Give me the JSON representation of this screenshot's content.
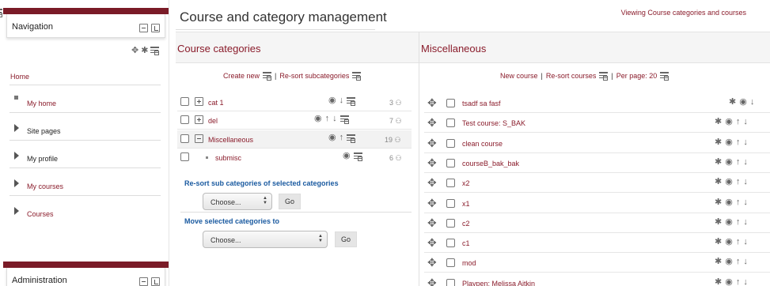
{
  "header": {
    "title": "Course and category management",
    "view_link": "Viewing Course categories and courses"
  },
  "navigation_block": {
    "title": "Navigation",
    "items": [
      {
        "label": "Home"
      },
      {
        "label": "My home"
      },
      {
        "label": "Site pages"
      },
      {
        "label": "My profile"
      },
      {
        "label": "My courses"
      },
      {
        "label": "Courses"
      }
    ]
  },
  "admin_block": {
    "title": "Administration"
  },
  "categories_panel": {
    "title": "Course categories",
    "create_new": "Create new",
    "resort": "Re-sort subcategories",
    "rows": [
      {
        "name": "cat 1",
        "count": "3"
      },
      {
        "name": "del",
        "count": "7"
      },
      {
        "name": "Miscellaneous",
        "count": "19"
      },
      {
        "name": "submisc",
        "count": "6"
      }
    ],
    "bulk": {
      "resort_title": "Re-sort sub categories of selected categories",
      "resort_select": "Choose...",
      "go": "Go",
      "move_title": "Move selected categories to",
      "move_select": "Choose..."
    }
  },
  "courses_panel": {
    "title": "Miscellaneous",
    "new_course": "New course",
    "resort_courses": "Re-sort courses",
    "per_page": "Per page: 20",
    "courses": [
      "tsadf sa fasf",
      "Test course: S_BAK",
      "clean course",
      "courseB_bak_bak",
      "x2",
      "x1",
      "c2",
      "c1",
      "mod",
      "Playpen: Melissa Aitkin"
    ]
  },
  "icons": {
    "move": "move-icon",
    "settings": "gear-icon",
    "view": "eye-icon",
    "up": "arrow-up-icon",
    "down": "arrow-down-icon",
    "edit": "edit-icon",
    "users": "users-icon"
  },
  "colors": {
    "brand": "#7a1b27",
    "link": "#8a1c2b",
    "bulk_heading": "#1a5aa0"
  }
}
